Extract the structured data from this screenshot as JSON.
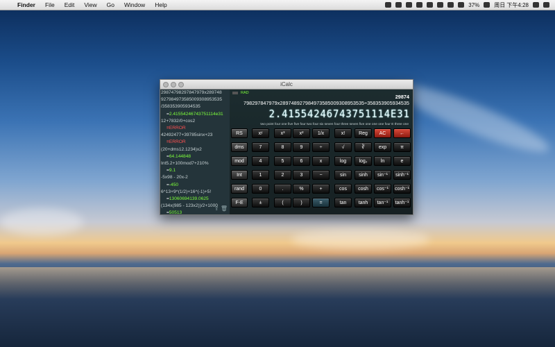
{
  "menubar": {
    "apple": "",
    "items": [
      "Finder",
      "File",
      "Edit",
      "View",
      "Go",
      "Window",
      "Help"
    ],
    "battery": "37%",
    "clock": "周日 下午4:28"
  },
  "window": {
    "title": "iCalc",
    "mode_rad": "RAD",
    "expression": "29874\n79829784797​9x2897489279849735850093089535​35÷358353905934535",
    "result": "2.41554246743751114E31",
    "spelled": "two  point four one five five four two four six seven four three seven five one one one four E three one"
  },
  "history": [
    {
      "t": "ln",
      "v": "298747982978479​79x289748"
    },
    {
      "t": "ln",
      "v": "927984973585009308953535"
    },
    {
      "t": "ln",
      "v": "/358353905934535"
    },
    {
      "t": "res",
      "v": "2.41554246743751114e31"
    },
    {
      "t": "ln",
      "v": "12+7832/0+cos2"
    },
    {
      "t": "err",
      "v": "ERROR"
    },
    {
      "t": "ln",
      "v": "42492477+39785sinx+23"
    },
    {
      "t": "err",
      "v": "ERROR"
    },
    {
      "t": "ln",
      "v": "(20+dms12.1234)x2"
    },
    {
      "t": "res",
      "v": "64.144848"
    },
    {
      "t": "ln",
      "v": "Int5.2+100mod7+210%"
    },
    {
      "t": "res",
      "v": "9.1"
    },
    {
      "t": "ln",
      "v": "-5x98 - 20x-2"
    },
    {
      "t": "res",
      "v": "-450"
    },
    {
      "t": "ln",
      "v": "6^13+9^(1/2)+16^(-1)+5!"
    },
    {
      "t": "res",
      "v": "13060694139.0625"
    },
    {
      "t": "ln",
      "v": "(134x(985 - 123x2))/2+1000"
    },
    {
      "t": "res",
      "v": "50513"
    }
  ],
  "keys": {
    "side": [
      "RS",
      "dms",
      "mod",
      "Int",
      "rand",
      "F-E"
    ],
    "rows": [
      [
        "xʸ",
        "x³",
        "x²",
        "1/x",
        "x!",
        "Reg",
        "AC",
        "←"
      ],
      [
        "7",
        "8",
        "9",
        "÷",
        "√",
        "∛",
        "exp",
        "π"
      ],
      [
        "4",
        "5",
        "6",
        "x",
        "log",
        "log₂",
        "ln",
        "e"
      ],
      [
        "1",
        "2",
        "3",
        "−",
        "sin",
        "sinh",
        "sin⁻¹",
        "sinh⁻¹"
      ],
      [
        "0",
        ".",
        "%",
        "+",
        "cos",
        "cosh",
        "cos⁻¹",
        "cosh⁻¹"
      ],
      [
        "±",
        "(",
        ")",
        "=",
        "tan",
        "tanh",
        "tan⁻¹",
        "tanh⁻¹"
      ]
    ]
  },
  "colors": {
    "result_green": "#7dff3a",
    "error_red": "#ff5050",
    "ac_red": "#d84a3a"
  }
}
